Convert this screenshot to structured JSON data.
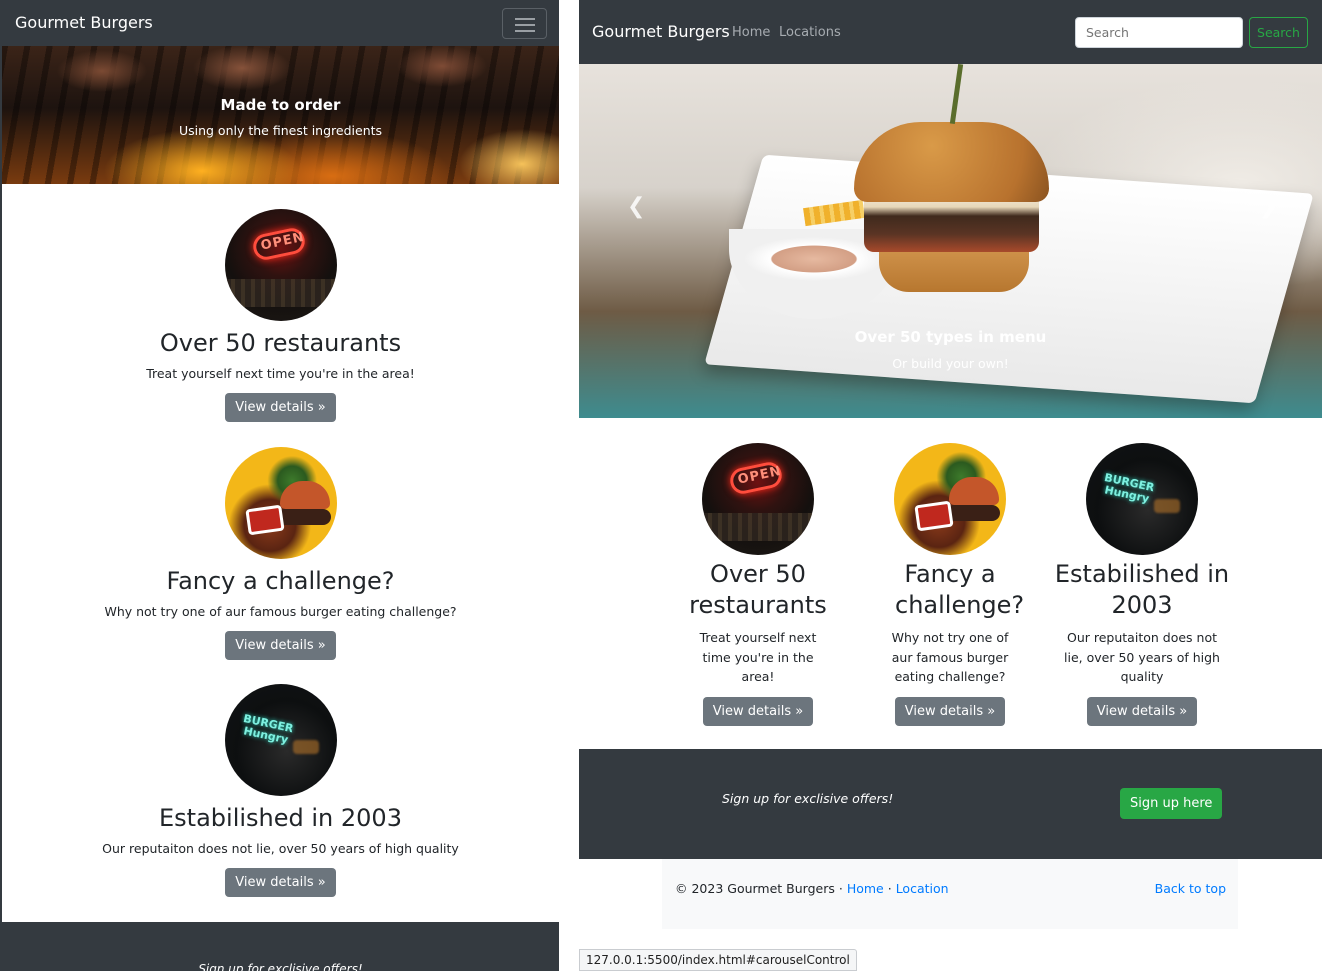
{
  "mobile": {
    "brand": "Gourmet Burgers",
    "hero": {
      "title": "Made to order",
      "subtitle": "Using only the finest ingredients"
    },
    "features": [
      {
        "title": "Over 50 restaurants",
        "text": "Treat yourself next time you're in the area!",
        "button": "View details »"
      },
      {
        "title": "Fancy a challenge?",
        "text": "Why not try one of aur famous burger eating challenge?",
        "button": "View details »"
      },
      {
        "title": "Estabilished in 2003",
        "text": "Our reputaiton does not lie, over 50 years of high quality",
        "button": "View details »"
      }
    ],
    "signup_text": "Sign up for exclisive offers!"
  },
  "desktop": {
    "brand": "Gourmet Burgers",
    "nav": {
      "home": "Home",
      "locations": "Locations"
    },
    "search": {
      "placeholder": "Search",
      "button": "Search"
    },
    "hero": {
      "title": "Over 50 types in menu",
      "subtitle": "Or build your own!"
    },
    "features": [
      {
        "title": "Over 50 restaurants",
        "text": "Treat yourself next time you're in the area!",
        "button": "View details »"
      },
      {
        "title": "Fancy a challenge?",
        "text": "Why not try one of aur famous burger eating challenge?",
        "button": "View details »"
      },
      {
        "title": "Estabilished in 2003",
        "text": "Our reputaiton does not lie, over 50 years of high quality",
        "button": "View details »"
      }
    ],
    "signup": {
      "text": "Sign up for exclisive offers!",
      "button": "Sign up here"
    },
    "footer": {
      "copyright": "© 2023 Gourmet Burgers ·",
      "home": "Home",
      "separator": "·",
      "location": "Location",
      "back_to_top": "Back to top"
    }
  },
  "status_bar": {
    "url": "127.0.0.1:5500/index.html#carouselControl"
  },
  "colors": {
    "navbar": "#343a40",
    "secondary": "#6c757d",
    "success": "#28a745",
    "link": "#007bff"
  },
  "icons": {
    "menu": "hamburger-icon",
    "prev": "chevron-left-icon",
    "next": "chevron-right-icon"
  }
}
